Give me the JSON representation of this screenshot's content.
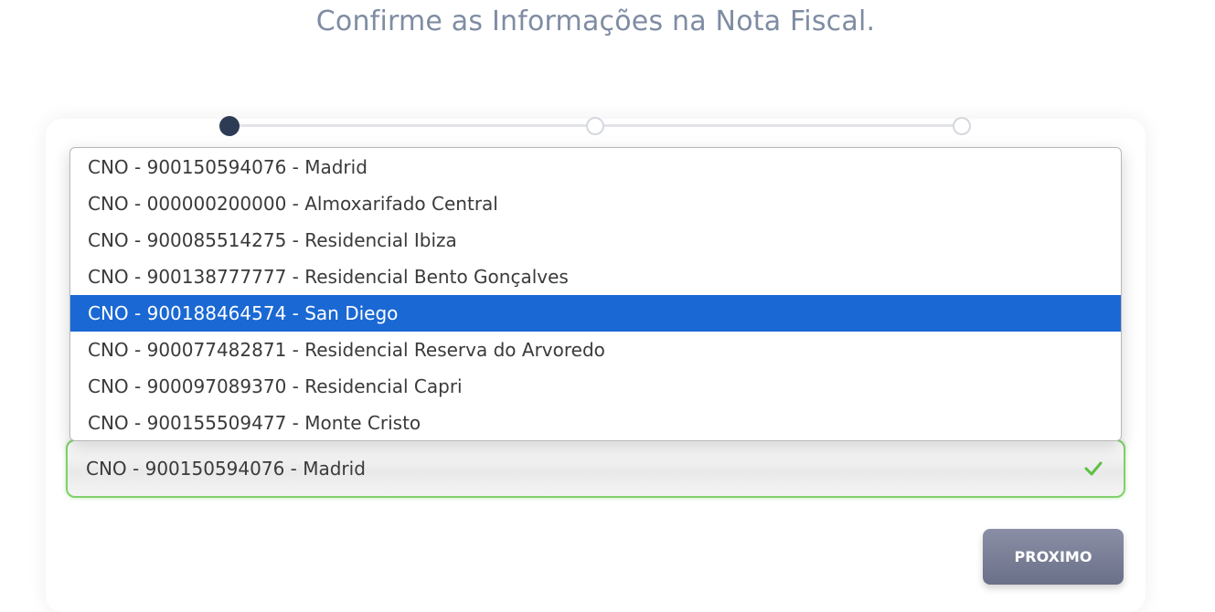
{
  "header": {
    "title": "Confirme as Informações na Nota Fiscal."
  },
  "stepper": {
    "current_step": 1,
    "total_steps": 3
  },
  "dropdown": {
    "options": [
      "CNO - 900150594076 - Madrid",
      "CNO - 000000200000 - Almoxarifado Central",
      "CNO - 900085514275 - Residencial Ibiza",
      "CNO - 900138777777 - Residencial Bento Gonçalves",
      "CNO - 900188464574 - San Diego",
      "CNO - 900077482871 - Residencial Reserva do Arvoredo",
      "CNO - 900097089370 - Residencial Capri",
      "CNO - 900155509477 - Monte Cristo"
    ],
    "highlighted_option": "CNO - 900188464574 - San Diego",
    "selected_value": "CNO - 900150594076 - Madrid",
    "valid_icon": "check-icon"
  },
  "actions": {
    "next_label": "PROXIMO"
  },
  "colors": {
    "highlight": "#1a68d4",
    "valid_border": "#7fd16a",
    "step_active": "#2e3b55",
    "button": "#7a7f97"
  }
}
